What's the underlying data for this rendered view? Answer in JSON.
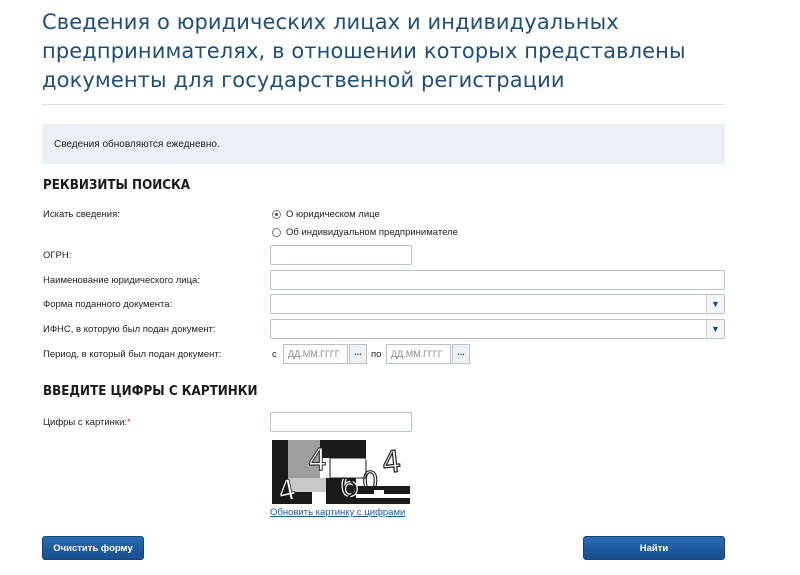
{
  "page": {
    "title": "Сведения о юридических лицах и индивидуальных предпринимателях, в отношении которых представлены документы для государственной регистрации"
  },
  "info": {
    "text": "Сведения обновляются ежедневно."
  },
  "search": {
    "section_title": "РЕКВИЗИТЫ ПОИСКА",
    "search_for_label": "Искать сведения:",
    "radio_options": [
      {
        "label": "О юридическом лице",
        "selected": true
      },
      {
        "label": "Об индивидуальном предпринимателе",
        "selected": false
      }
    ],
    "ogrn_label": "ОГРН:",
    "ogrn_value": "",
    "name_label": "Наименование юридического лица:",
    "name_value": "",
    "doc_form_label": "Форма поданного документа:",
    "doc_form_value": "",
    "ifns_label": "ИФНС, в которую был подан документ:",
    "ifns_value": "",
    "period_label": "Период, в который был подан документ:",
    "period_from_label": "с",
    "period_to_label": "по",
    "date_placeholder": "ДД.ММ.ГГГГ",
    "date_button": "..."
  },
  "captcha": {
    "section_title": "ВВЕДИТЕ ЦИФРЫ С КАРТИНКИ",
    "label": "Цифры с картинки:",
    "required_mark": "*",
    "value": "",
    "digits": "44604",
    "refresh_link": "Обновить картинку с цифрами"
  },
  "buttons": {
    "clear": "Очистить форму",
    "submit": "Найти"
  },
  "colors": {
    "title": "#1f4e79",
    "info_bg": "#eaf0f5",
    "button": "#1f5c9e",
    "link": "#1f58a5"
  }
}
